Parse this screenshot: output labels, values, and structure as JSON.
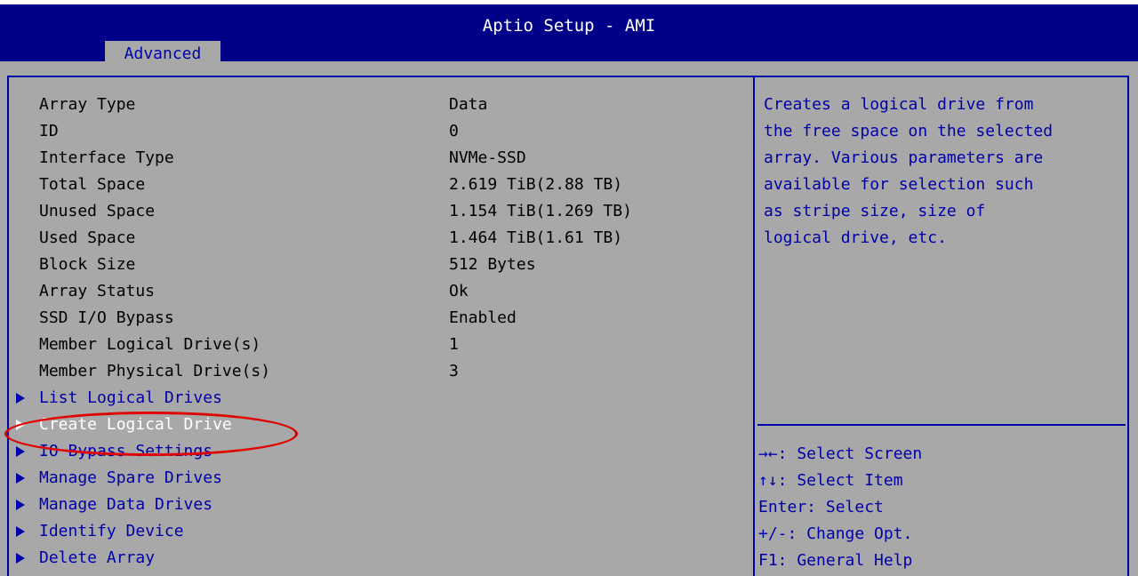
{
  "header": {
    "title": "Aptio Setup - AMI",
    "active_tab": "Advanced"
  },
  "info": [
    {
      "label": "Array Type",
      "value": "Data"
    },
    {
      "label": "ID",
      "value": "0"
    },
    {
      "label": "Interface Type",
      "value": "NVMe-SSD"
    },
    {
      "label": "Total Space",
      "value": "2.619 TiB(2.88 TB)"
    },
    {
      "label": "Unused Space",
      "value": "1.154 TiB(1.269 TB)"
    },
    {
      "label": "Used Space",
      "value": "1.464 TiB(1.61 TB)"
    },
    {
      "label": "Block Size",
      "value": "512 Bytes"
    },
    {
      "label": "Array Status",
      "value": "Ok"
    },
    {
      "label": "SSD I/O Bypass",
      "value": "Enabled"
    },
    {
      "label": "Member Logical Drive(s)",
      "value": "1"
    },
    {
      "label": "Member Physical Drive(s)",
      "value": "3"
    }
  ],
  "menu": [
    {
      "label": "List Logical Drives"
    },
    {
      "label": "Create Logical Drive"
    },
    {
      "label": "IO Bypass Settings"
    },
    {
      "label": "Manage Spare Drives"
    },
    {
      "label": "Manage Data Drives"
    },
    {
      "label": "Identify Device"
    },
    {
      "label": "Delete Array"
    }
  ],
  "help": {
    "text": "Creates a logical drive from\nthe free space on the selected\narray. Various parameters are\navailable for selection such\nas stripe size, size of\nlogical drive, etc.",
    "keys": [
      "→←: Select Screen",
      "↑↓: Select Item",
      "Enter: Select",
      "+/-: Change Opt.",
      "F1: General Help"
    ]
  },
  "colors": {
    "header_bg": "#000088",
    "panel_bg": "#a8a8a8",
    "accent_blue": "#0000a8",
    "annotation_red": "#e00000"
  }
}
